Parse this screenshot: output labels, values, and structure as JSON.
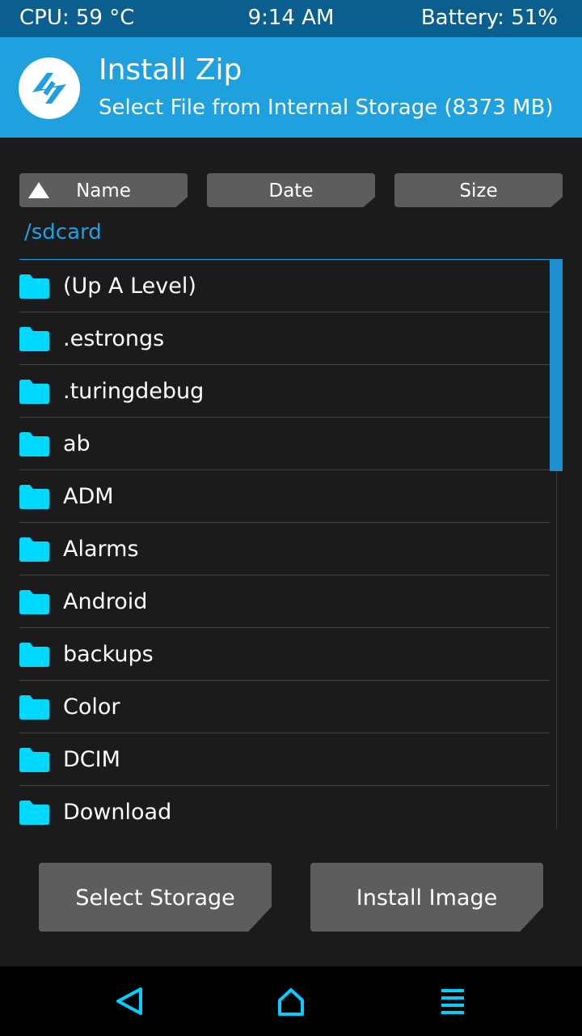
{
  "status": {
    "cpu": "CPU: 59 °C",
    "time": "9:14 AM",
    "battery": "Battery: 51%"
  },
  "header": {
    "title": "Install Zip",
    "subtitle": "Select File from Internal Storage (8373 MB)",
    "logo_icon": "twrp-logo-icon"
  },
  "sort": {
    "name_label": "Name",
    "date_label": "Date",
    "size_label": "Size",
    "active": "name",
    "direction_icon": "triangle-up-icon"
  },
  "path": "/sdcard",
  "files": [
    {
      "name": "(Up A Level)",
      "icon": "folder-icon"
    },
    {
      "name": ".estrongs",
      "icon": "folder-icon"
    },
    {
      "name": ".turingdebug",
      "icon": "folder-icon"
    },
    {
      "name": "ab",
      "icon": "folder-icon"
    },
    {
      "name": "ADM",
      "icon": "folder-icon"
    },
    {
      "name": "Alarms",
      "icon": "folder-icon"
    },
    {
      "name": "Android",
      "icon": "folder-icon"
    },
    {
      "name": "backups",
      "icon": "folder-icon"
    },
    {
      "name": "Color",
      "icon": "folder-icon"
    },
    {
      "name": "DCIM",
      "icon": "folder-icon"
    },
    {
      "name": "Download",
      "icon": "folder-icon"
    }
  ],
  "buttons": {
    "select_storage": "Select Storage",
    "install_image": "Install Image"
  },
  "nav": {
    "back_icon": "back-icon",
    "home_icon": "home-icon",
    "menu_icon": "menu-icon"
  },
  "colors": {
    "status_bar": "#0b5f8e",
    "header": "#1fa0df",
    "accent": "#1ea1e2",
    "folder": "#00d9ff",
    "background": "#1b1b1b",
    "button": "#5d5d5d",
    "nav_icons": "#00cfff"
  }
}
